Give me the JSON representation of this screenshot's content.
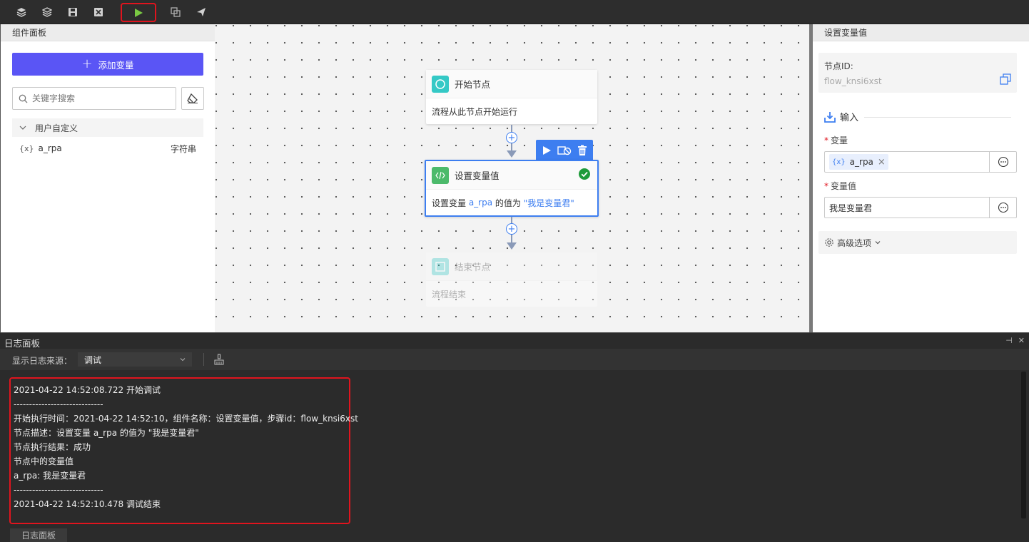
{
  "toolbar": {
    "icons": [
      "layers-icon",
      "layers-alt-icon",
      "save-icon",
      "close-box-icon",
      "run-icon",
      "copy-icon",
      "send-icon"
    ],
    "accent_run": "#7ac943",
    "highlight": "#e0141e"
  },
  "left_panel": {
    "title": "组件面板",
    "add_variable_label": "添加变量",
    "search_placeholder": "关键字搜索",
    "group_label": "用户自定义",
    "variables": [
      {
        "icon": "{x}",
        "name": "a_rpa",
        "type": "字符串"
      }
    ]
  },
  "canvas": {
    "start_node": {
      "title": "开始节点",
      "description": "流程从此节点开始运行"
    },
    "set_node": {
      "title": "设置变量值",
      "desc_prefix": "设置变量 ",
      "desc_var": "a_rpa",
      "desc_middle": " 的值为 ",
      "desc_value": "\"我是变量君\"",
      "status": "success"
    },
    "end_node": {
      "title": "结束节点",
      "description": "流程结束"
    },
    "accent": "#3d7ef0"
  },
  "right_panel": {
    "title": "设置变量值",
    "node_id_label": "节点ID:",
    "node_id_value": "flow_knsi6xst",
    "input_section": "输入",
    "variable_label": "变量",
    "variable_tag_icon": "{x}",
    "variable_tag_value": "a_rpa",
    "value_label": "变量值",
    "value_text": "我是变量君",
    "advanced_label": "高级选项"
  },
  "log_panel": {
    "title": "日志面板",
    "source_label": "显示日志来源：",
    "source_value": "调试",
    "lines": [
      "2021-04-22 14:52:08.722 开始调试",
      "-----------------------------",
      "开始执行时间：2021-04-22 14:52:10，组件名称：设置变量值，步骤id：flow_knsi6xst",
      "节点描述：设置变量 a_rpa 的值为 \"我是变量君\"",
      "节点执行结果：成功",
      "节点中的变量值",
      "a_rpa: 我是变量君",
      "-----------------------------",
      "2021-04-22 14:52:10.478 调试结束"
    ],
    "footer_tab": "日志面板"
  }
}
